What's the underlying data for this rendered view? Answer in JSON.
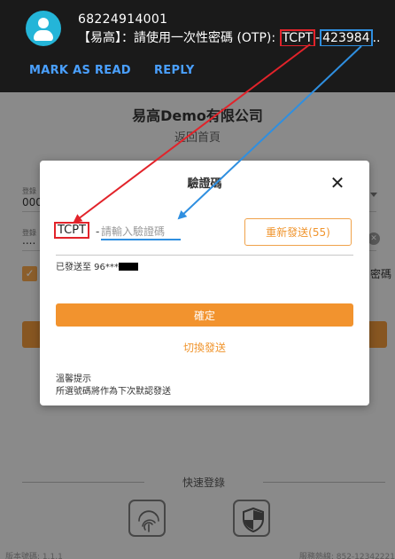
{
  "notification": {
    "sender": "68224914001",
    "message_start": "【易高】：請使用一次性密碼 (OTP): ",
    "otp_prefix": "TCPT",
    "separator": "-",
    "otp_code": "423984",
    "ellipsis": "..",
    "actions": {
      "mark_read": "MARK AS READ",
      "reply": "REPLY"
    }
  },
  "page": {
    "company": "易高Demo有限公司",
    "back_home": "返回首頁",
    "field1_label": "登錄",
    "field1_value": "000",
    "field2_label": "登錄",
    "field2_value": "....",
    "remember_label": "密碼",
    "quick_login": "快速登錄",
    "version": "版本號碼: 1.1.1",
    "hotline": "服務熱線: 852-12342221"
  },
  "dialog": {
    "title": "驗證碼",
    "close_icon": "close-icon",
    "prefix": "TCPT",
    "dash": "-",
    "input_placeholder": "請輸入驗證碼",
    "resend_label": "重新發送(55)",
    "sent_to": "已發送至 96***",
    "confirm_label": "確定",
    "switch_label": "切換發送",
    "tip_title": "溫馨提示",
    "tip_text": "所選號碼將作為下次默認發送"
  },
  "colors": {
    "accent_orange": "#f2932e",
    "highlight_red": "#e2232a",
    "highlight_blue": "#2f8fe0",
    "notification_bg": "#1a1a1a"
  }
}
